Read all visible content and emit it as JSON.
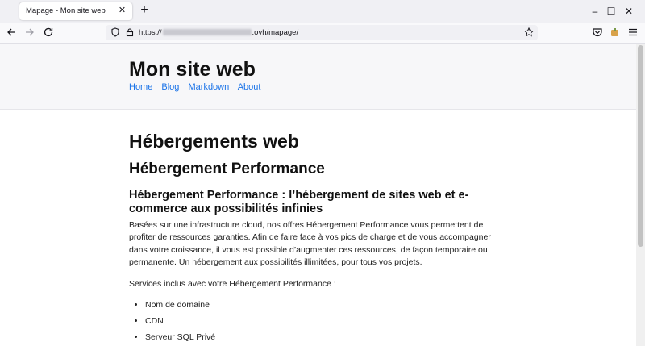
{
  "browser": {
    "tab_title": "Mapage - Mon site web",
    "tab_close": "✕",
    "new_tab": "+",
    "url_prefix": "https://",
    "url_suffix": ".ovh/mapage/",
    "window_controls": {
      "minimize": "–",
      "maximize": "☐",
      "close": "✕"
    },
    "icons": {
      "back": "back-arrow-icon",
      "forward": "forward-arrow-icon",
      "reload": "reload-icon",
      "shield": "tracking-protection-icon",
      "lock": "lock-icon",
      "bookmark": "star-icon",
      "pocket": "pocket-icon",
      "extension": "extension-icon",
      "menu": "hamburger-menu-icon"
    }
  },
  "site": {
    "title": "Mon site web",
    "nav": [
      "Home",
      "Blog",
      "Markdown",
      "About"
    ]
  },
  "content": {
    "h1": "Hébergements web",
    "h2": "Hébergement Performance",
    "h3": "Hébergement Performance : l’hébergement de sites web et e-commerce aux possibilités infinies",
    "paragraph": "Basées sur une infrastructure cloud, nos offres Hébergement Performance vous permettent de profiter de ressources garanties. Afin de faire face à vos pics de charge et de vous accompagner dans votre croissance, il vous est possible d’augmenter ces ressources, de façon temporaire ou permanente. Un hébergement aux possibilités illimitées, pour tous vos projets.",
    "services_intro": "Services inclus avec votre Hébergement Performance :",
    "services": [
      "Nom de domaine",
      "CDN",
      "Serveur SQL Privé"
    ]
  },
  "colors": {
    "link": "#1a73e8",
    "header_bg": "#f7f7f9",
    "tabstrip_bg": "#f0f0f4"
  }
}
